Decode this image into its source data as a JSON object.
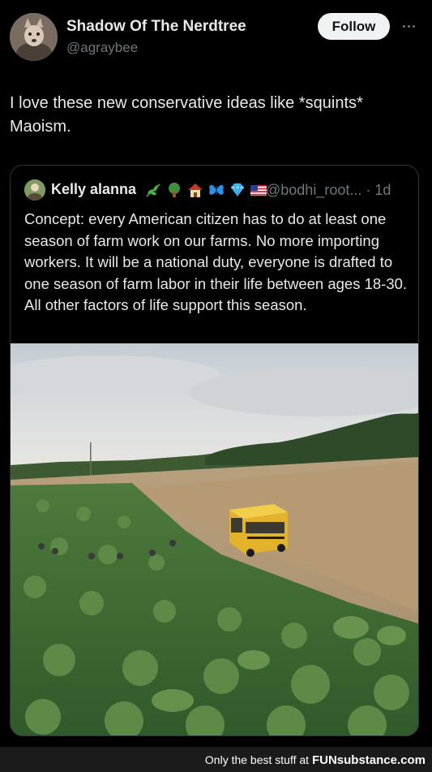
{
  "post": {
    "author_name": "Shadow Of The Nerdtree",
    "author_handle": "@agraybee",
    "follow_label": "Follow",
    "text": "I love these new conservative ideas like *squints*\nMaoism."
  },
  "quote": {
    "author_name": "Kelly alanna",
    "emojis": [
      "herb-emoji",
      "tree-emoji",
      "house-emoji",
      "butterfly-emoji",
      "gem-emoji",
      "us-flag-emoji"
    ],
    "handle_time": "@bodhi_root... · 1d",
    "text": "Concept: every American citizen has to do at least one season of farm work on our farms. No more importing workers. It will be a national duty, everyone is drafted to one season of farm labor in their life between ages 18-30. All other factors of life support this season.",
    "image_alt": "farm field with workers and yellow school bus"
  },
  "watermark": {
    "text": "Only the best stuff at ",
    "brand": "FUNsubstance.com"
  },
  "colors": {
    "background": "#000000",
    "text": "#e7e9ea",
    "secondary": "#71767b",
    "follow_bg": "#eff3f4"
  }
}
